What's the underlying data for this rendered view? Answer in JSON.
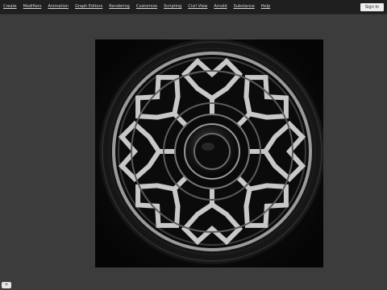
{
  "menu": {
    "items": [
      {
        "label": "Create"
      },
      {
        "label": "Modifiers"
      },
      {
        "label": "Animation"
      },
      {
        "label": "Graph Editors"
      },
      {
        "label": "Rendering"
      },
      {
        "label": "Customize"
      },
      {
        "label": "Scripting"
      },
      {
        "label": "Civil View"
      },
      {
        "label": "Arnold"
      },
      {
        "label": "Substance"
      },
      {
        "label": "Help"
      }
    ],
    "signin_label": "Sign In"
  },
  "viewport": {
    "subject": "wheel-render"
  },
  "corner_badge": {
    "icon": "plus-icon"
  },
  "colors": {
    "menubar": "#1f1f1f",
    "workspace": "#3c3c3c",
    "accent_silver": "#c8c8c8"
  }
}
